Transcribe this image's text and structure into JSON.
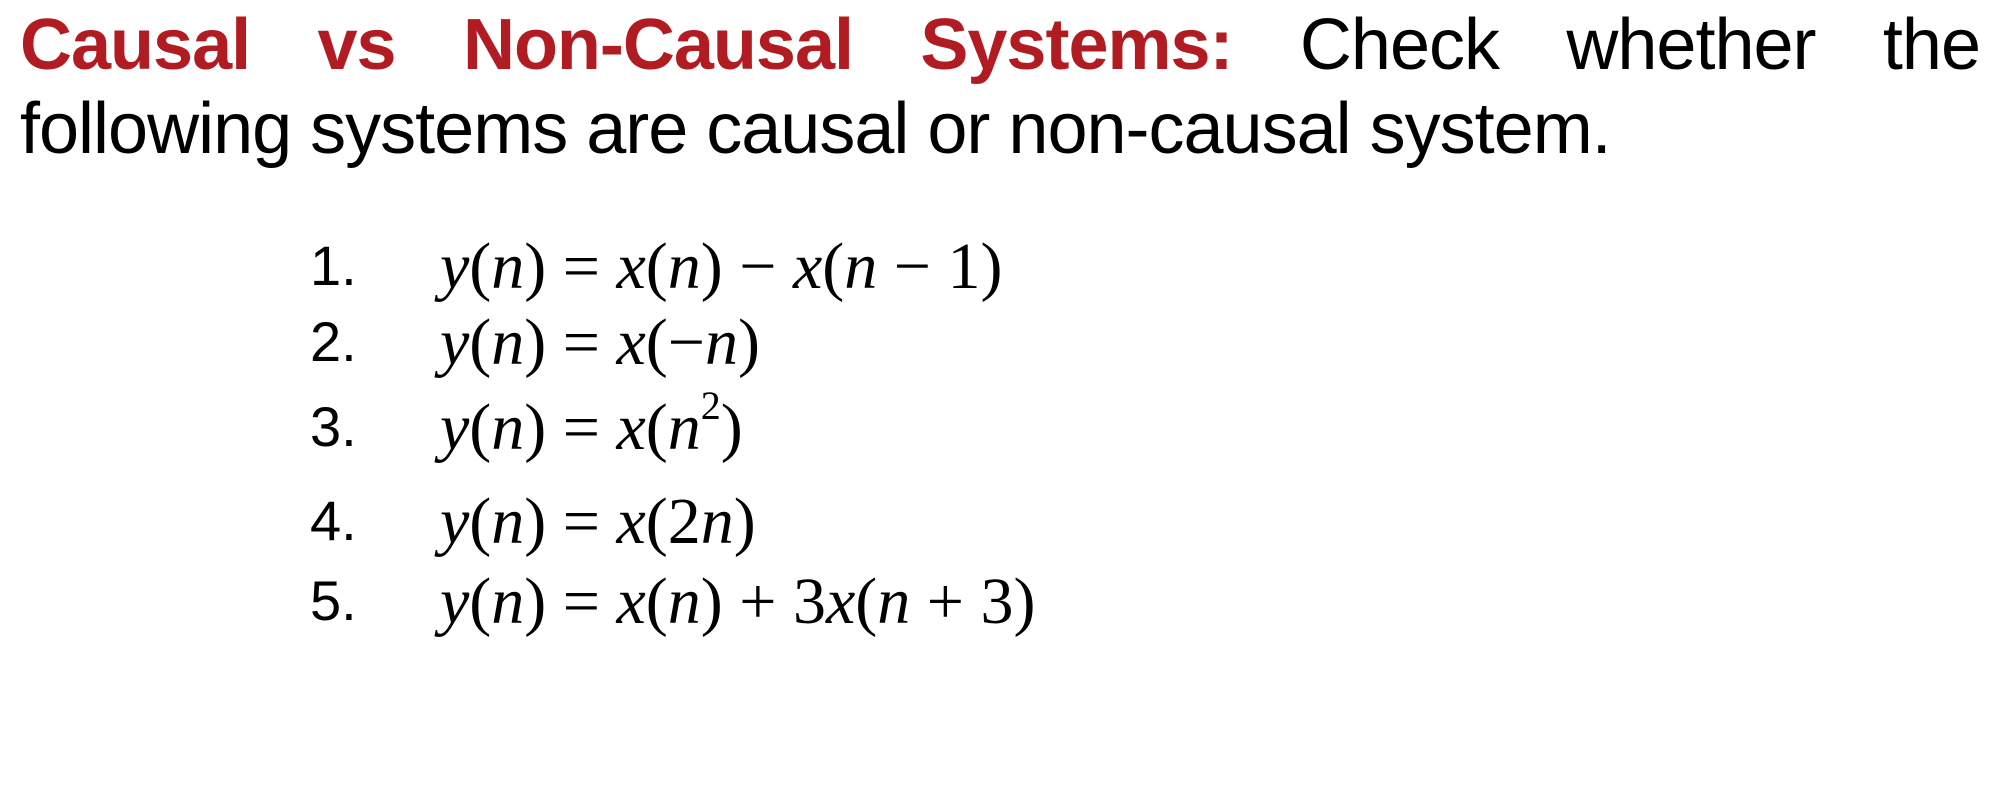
{
  "heading": {
    "title": "Causal vs Non-Causal Systems:",
    "body_line1": " Check whether the",
    "body_line2": "following systems are causal or non-causal system."
  },
  "items": [
    {
      "num": "1.",
      "eq_html": "y<span class='up'>(</span>n<span class='up'>)</span> <span class='up'>=</span> x<span class='up'>(</span>n<span class='up'>)</span> <span class='up'>−</span> x<span class='up'>(</span>n <span class='up'>−</span> <span class='up'>1)</span>"
    },
    {
      "num": "2.",
      "eq_html": "y<span class='up'>(</span>n<span class='up'>)</span> <span class='up'>=</span> x<span class='up'>(−</span>n<span class='up'>)</span>"
    },
    {
      "num": "3.",
      "eq_html": "y<span class='up'>(</span>n<span class='up'>)</span> <span class='up'>=</span> x<span class='up'>(</span>n<sup class='up'>2</sup><span class='up'>)</span>"
    },
    {
      "num": "4.",
      "eq_html": "y<span class='up'>(</span>n<span class='up'>)</span> <span class='up'>=</span> x<span class='up'>(2</span>n<span class='up'>)</span>"
    },
    {
      "num": "5.",
      "eq_html": "y<span class='up'>(</span>n<span class='up'>)</span> <span class='up'>=</span> x<span class='up'>(</span>n<span class='up'>)</span> <span class='up'>+ 3</span>x<span class='up'>(</span>n <span class='up'>+ 3)</span>"
    }
  ]
}
